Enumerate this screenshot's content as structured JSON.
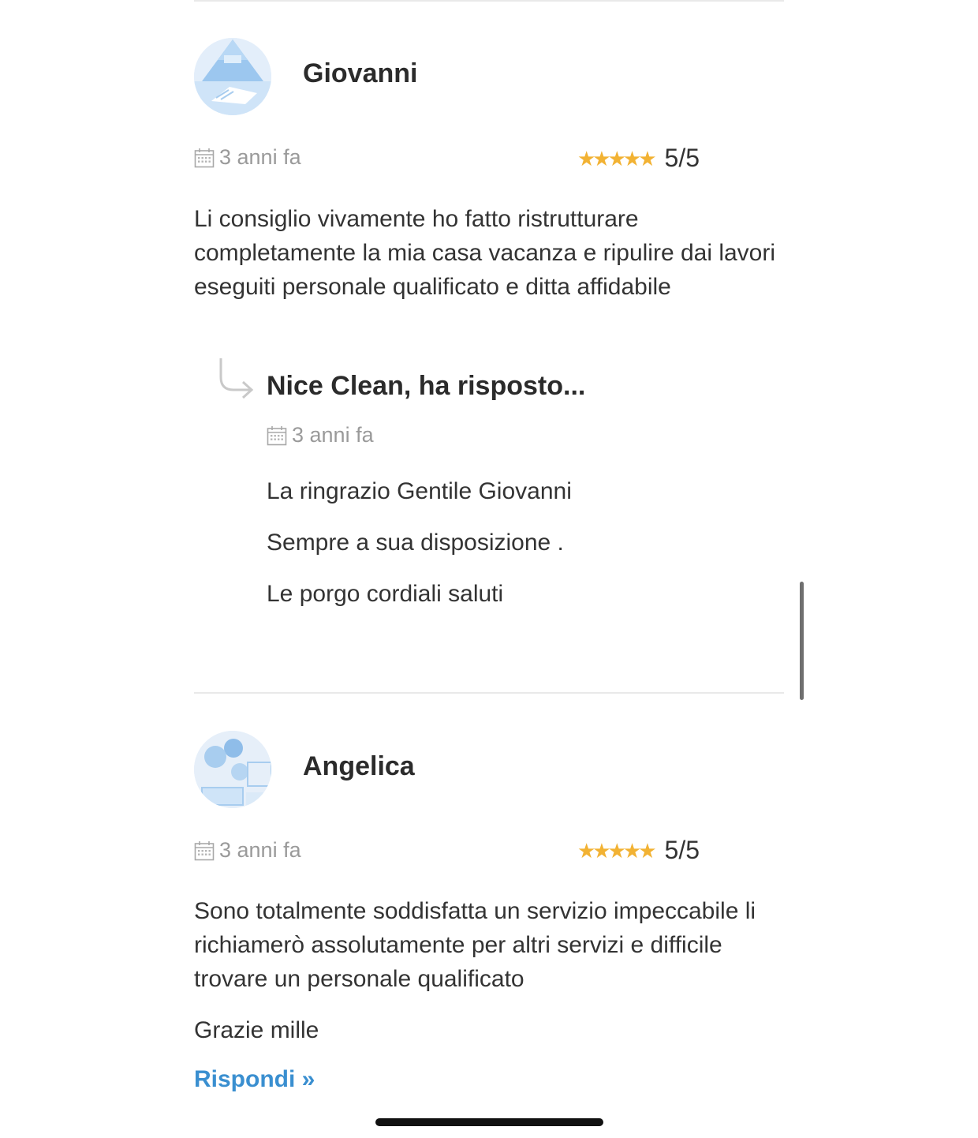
{
  "reviews": [
    {
      "author": "Giovanni",
      "date": "3 anni fa",
      "stars": "★★★★★",
      "score": "5/5",
      "rating_value": 5,
      "text": "Li consiglio vivamente ho fatto ristrutturare completamente la mia casa vacanza e ripulire dai lavori eseguiti personale qualificato e ditta affidabile",
      "reply": {
        "title": "Nice Clean, ha risposto...",
        "date": "3 anni fa",
        "lines": [
          "La ringrazio Gentile Giovanni",
          "Sempre a sua disposizione .",
          "Le porgo cordiali saluti"
        ]
      }
    },
    {
      "author": "Angelica",
      "date": "3 anni fa",
      "stars": "★★★★★",
      "score": "5/5",
      "rating_value": 5,
      "text": "Sono totalmente soddisfatta un servizio impeccabile li richiamerò assolutamente per altri servizi e difficile trovare un personale qualificato",
      "extra_text": "Grazie mille",
      "action": "Rispondi »"
    }
  ],
  "colors": {
    "star": "#f2b233",
    "link": "#3a8fd0",
    "muted_text": "#9a9a9a",
    "body_text": "#333333",
    "divider": "#e9e9e9"
  },
  "icons": [
    "calendar-icon",
    "reply-arrow-icon",
    "star-icon"
  ]
}
